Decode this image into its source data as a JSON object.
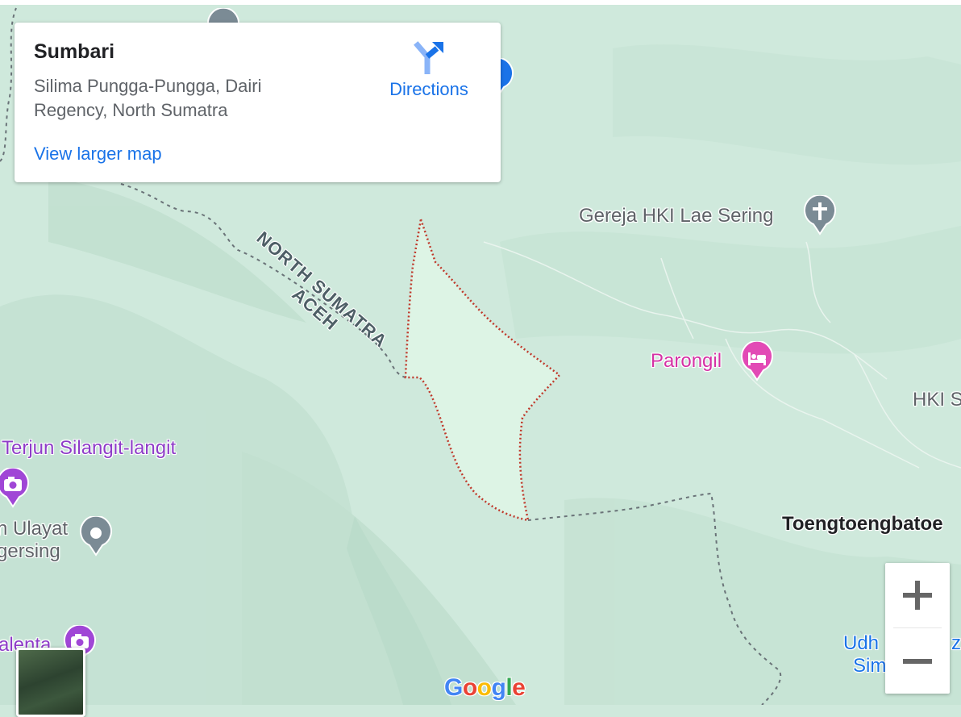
{
  "info_card": {
    "title": "Sumbari",
    "address": "Silima Pungga-Pungga, Dairi Regency, North Sumatra",
    "view_larger_map": "View larger map",
    "directions_label": "Directions"
  },
  "map": {
    "region_labels": {
      "north": "NORTH SUMATRA",
      "south": "ACEH"
    },
    "places": [
      {
        "name": "Gereja HKI Lae Sering",
        "type": "church",
        "icon": "cross-icon"
      },
      {
        "name": "Parongil",
        "type": "hotel",
        "icon": "bed-icon"
      },
      {
        "name": "HKI S",
        "type": "church",
        "icon": "cross-icon"
      },
      {
        "name": "Terjun Silangit-langit",
        "type": "tourist-attraction",
        "icon": "camera-icon"
      },
      {
        "name": "n Ulayat",
        "line2": "gersing",
        "type": "place",
        "icon": "dot-icon"
      },
      {
        "name": "alenta",
        "type": "tourist-attraction",
        "icon": "camera-icon"
      },
      {
        "name": "Toengtoengbatoe",
        "type": "town",
        "icon": "none"
      },
      {
        "name": "Udh",
        "name_b": "z",
        "line2": "Sim",
        "line2_b": "",
        "type": "place",
        "icon": "none"
      }
    ]
  },
  "controls": {
    "zoom_in": "+",
    "zoom_out": "−"
  },
  "attribution": {
    "logo_letters": [
      "G",
      "o",
      "o",
      "g",
      "l",
      "e"
    ],
    "logo_colors": [
      "#4285f4",
      "#ea4335",
      "#fbbc05",
      "#4285f4",
      "#34a853",
      "#ea4335"
    ]
  },
  "colors": {
    "map_bg": "#cfe9dc",
    "boundary_red": "#c0392b",
    "link_blue": "#1a73e8",
    "hotel_pink": "#d431a4",
    "attraction_purple": "#8e3cc8"
  }
}
